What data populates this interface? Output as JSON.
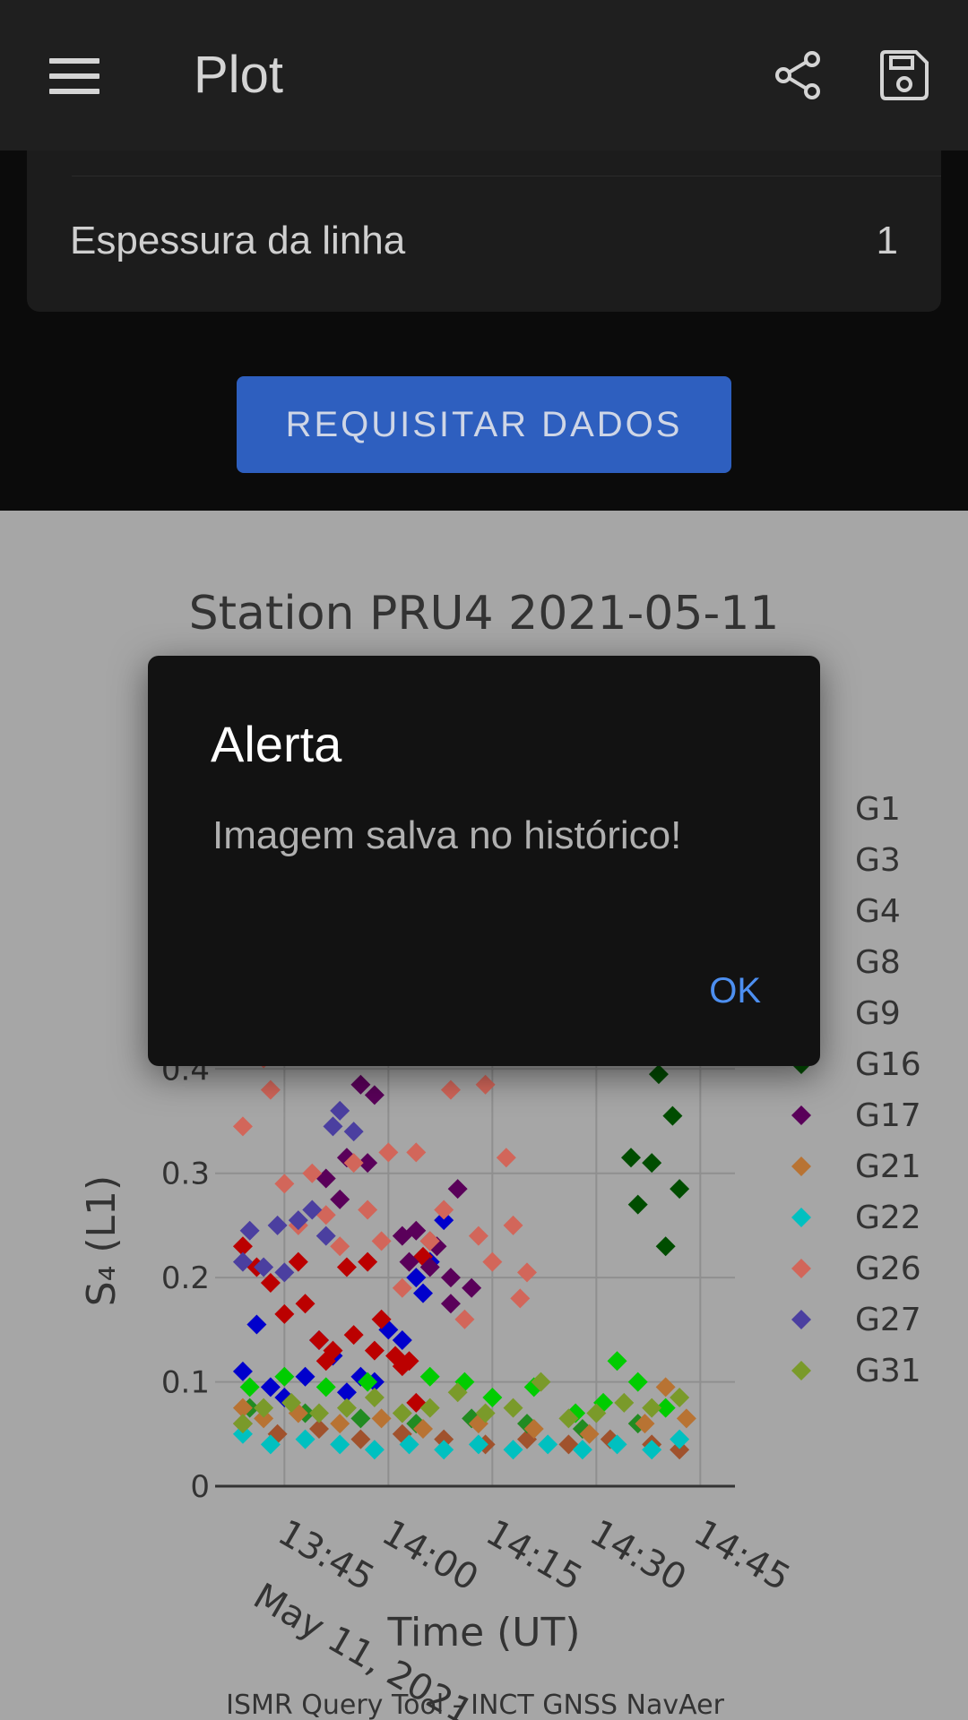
{
  "appbar": {
    "title": "Plot",
    "icons": [
      "menu-icon",
      "share-icon",
      "save-icon"
    ]
  },
  "settings": {
    "line_thickness_label": "Espessura da linha",
    "line_thickness_value": "1"
  },
  "request_button_label": "REQUISITAR DADOS",
  "dialog": {
    "title": "Alerta",
    "message": "Imagem salva no histórico!",
    "ok_label": "OK"
  },
  "colors": {
    "appbar": "#1f1f1f",
    "button": "#2e5fbf",
    "plot_bg": "#a6a6a6",
    "dialog_bg": "#121212",
    "dialog_ok": "#4d8ff0"
  },
  "chart_data": {
    "type": "scatter",
    "title": "Station PRU4 2021-05-11",
    "xlabel": "Time (UT)",
    "ylabel": "S₄ (L1)",
    "x_range": [
      "13:35",
      "14:50"
    ],
    "ylim": [
      0,
      0.42
    ],
    "x_ticks": [
      "13:45",
      "14:00",
      "14:15",
      "14:30",
      "14:45"
    ],
    "x_tick_sublabel": "May 11, 2021",
    "y_ticks": [
      "0",
      "0.1",
      "0.2",
      "0.3",
      "0.4"
    ],
    "grid": true,
    "legend_position": "right",
    "footer": "ISMR Query Tool - INCT GNSS NavAer",
    "marker": "diamond",
    "series": [
      {
        "name": "G1",
        "color": "#0000cc",
        "points": [
          [
            "13:39",
            0.11
          ],
          [
            "13:41",
            0.155
          ],
          [
            "13:43",
            0.095
          ],
          [
            "13:45",
            0.085
          ],
          [
            "13:48",
            0.105
          ],
          [
            "13:50",
            0.14
          ],
          [
            "13:52",
            0.125
          ],
          [
            "13:54",
            0.09
          ],
          [
            "13:56",
            0.105
          ],
          [
            "13:58",
            0.1
          ],
          [
            "14:00",
            0.15
          ],
          [
            "14:02",
            0.14
          ],
          [
            "14:04",
            0.2
          ],
          [
            "14:05",
            0.185
          ],
          [
            "14:06",
            0.215
          ],
          [
            "14:08",
            0.255
          ]
        ]
      },
      {
        "name": "G3",
        "color": "#bb0000",
        "points": [
          [
            "13:39",
            0.23
          ],
          [
            "13:41",
            0.21
          ],
          [
            "13:43",
            0.195
          ],
          [
            "13:45",
            0.165
          ],
          [
            "13:47",
            0.215
          ],
          [
            "13:48",
            0.175
          ],
          [
            "13:50",
            0.14
          ],
          [
            "13:51",
            0.12
          ],
          [
            "13:52",
            0.13
          ],
          [
            "13:54",
            0.21
          ],
          [
            "13:55",
            0.145
          ],
          [
            "13:57",
            0.215
          ],
          [
            "13:58",
            0.13
          ],
          [
            "13:59",
            0.16
          ],
          [
            "14:01",
            0.125
          ],
          [
            "14:02",
            0.115
          ],
          [
            "14:03",
            0.12
          ],
          [
            "14:05",
            0.22
          ],
          [
            "14:06",
            0.235
          ],
          [
            "14:04",
            0.08
          ]
        ]
      },
      {
        "name": "G4",
        "color": "#a0522d",
        "points": [
          [
            "13:39",
            0.06
          ],
          [
            "13:44",
            0.05
          ],
          [
            "13:50",
            0.055
          ],
          [
            "13:56",
            0.045
          ],
          [
            "14:02",
            0.05
          ],
          [
            "14:08",
            0.045
          ],
          [
            "14:14",
            0.04
          ],
          [
            "14:20",
            0.045
          ],
          [
            "14:26",
            0.04
          ],
          [
            "14:32",
            0.045
          ],
          [
            "14:38",
            0.04
          ],
          [
            "14:42",
            0.035
          ]
        ]
      },
      {
        "name": "G8",
        "color": "#228b22",
        "points": [
          [
            "13:40",
            0.075
          ],
          [
            "13:48",
            0.07
          ],
          [
            "13:56",
            0.065
          ],
          [
            "14:04",
            0.06
          ],
          [
            "14:12",
            0.065
          ],
          [
            "14:20",
            0.06
          ],
          [
            "14:28",
            0.055
          ],
          [
            "14:36",
            0.06
          ]
        ]
      },
      {
        "name": "G9",
        "color": "#00cc00",
        "points": [
          [
            "13:40",
            0.095
          ],
          [
            "13:45",
            0.105
          ],
          [
            "13:51",
            0.095
          ],
          [
            "13:57",
            0.1
          ],
          [
            "14:06",
            0.105
          ],
          [
            "14:11",
            0.1
          ],
          [
            "14:15",
            0.085
          ],
          [
            "14:21",
            0.095
          ],
          [
            "14:27",
            0.07
          ],
          [
            "14:31",
            0.08
          ],
          [
            "14:33",
            0.12
          ],
          [
            "14:36",
            0.1
          ],
          [
            "14:40",
            0.075
          ]
        ]
      },
      {
        "name": "G16",
        "color": "#004d00",
        "points": [
          [
            "14:35",
            0.315
          ],
          [
            "14:36",
            0.27
          ],
          [
            "14:38",
            0.31
          ],
          [
            "14:39",
            0.395
          ],
          [
            "14:40",
            0.23
          ],
          [
            "14:41",
            0.355
          ],
          [
            "14:42",
            0.285
          ]
        ]
      },
      {
        "name": "G17",
        "color": "#5a005a",
        "points": [
          [
            "13:51",
            0.295
          ],
          [
            "13:53",
            0.275
          ],
          [
            "13:54",
            0.315
          ],
          [
            "13:56",
            0.385
          ],
          [
            "13:57",
            0.31
          ],
          [
            "13:58",
            0.375
          ],
          [
            "14:02",
            0.24
          ],
          [
            "14:03",
            0.215
          ],
          [
            "14:04",
            0.245
          ],
          [
            "14:06",
            0.21
          ],
          [
            "14:07",
            0.23
          ],
          [
            "14:09",
            0.2
          ],
          [
            "14:10",
            0.285
          ],
          [
            "14:12",
            0.19
          ],
          [
            "14:09",
            0.175
          ]
        ]
      },
      {
        "name": "G21",
        "color": "#b87333",
        "points": [
          [
            "13:39",
            0.075
          ],
          [
            "13:42",
            0.065
          ],
          [
            "13:47",
            0.07
          ],
          [
            "13:53",
            0.06
          ],
          [
            "13:59",
            0.065
          ],
          [
            "14:05",
            0.055
          ],
          [
            "14:13",
            0.06
          ],
          [
            "14:21",
            0.055
          ],
          [
            "14:29",
            0.05
          ],
          [
            "14:37",
            0.06
          ],
          [
            "14:40",
            0.095
          ],
          [
            "14:43",
            0.065
          ]
        ]
      },
      {
        "name": "G22",
        "color": "#00c0c0",
        "points": [
          [
            "13:39",
            0.05
          ],
          [
            "13:43",
            0.04
          ],
          [
            "13:48",
            0.045
          ],
          [
            "13:53",
            0.04
          ],
          [
            "13:58",
            0.035
          ],
          [
            "14:03",
            0.04
          ],
          [
            "14:08",
            0.035
          ],
          [
            "14:13",
            0.04
          ],
          [
            "14:18",
            0.035
          ],
          [
            "14:23",
            0.04
          ],
          [
            "14:28",
            0.035
          ],
          [
            "14:33",
            0.04
          ],
          [
            "14:38",
            0.035
          ],
          [
            "14:42",
            0.045
          ]
        ]
      },
      {
        "name": "G26",
        "color": "#d2665a",
        "points": [
          [
            "13:39",
            0.345
          ],
          [
            "13:42",
            0.41
          ],
          [
            "13:43",
            0.38
          ],
          [
            "13:45",
            0.29
          ],
          [
            "13:47",
            0.25
          ],
          [
            "13:49",
            0.3
          ],
          [
            "13:51",
            0.26
          ],
          [
            "13:53",
            0.23
          ],
          [
            "13:55",
            0.31
          ],
          [
            "13:57",
            0.265
          ],
          [
            "13:59",
            0.235
          ],
          [
            "14:00",
            0.32
          ],
          [
            "14:02",
            0.19
          ],
          [
            "14:04",
            0.32
          ],
          [
            "14:06",
            0.235
          ],
          [
            "14:08",
            0.265
          ],
          [
            "14:09",
            0.38
          ],
          [
            "14:11",
            0.16
          ],
          [
            "14:13",
            0.24
          ],
          [
            "14:14",
            0.385
          ],
          [
            "14:15",
            0.215
          ],
          [
            "14:17",
            0.315
          ],
          [
            "14:18",
            0.25
          ],
          [
            "14:19",
            0.18
          ],
          [
            "14:20",
            0.205
          ]
        ]
      },
      {
        "name": "G27",
        "color": "#4b3fa0",
        "points": [
          [
            "13:39",
            0.215
          ],
          [
            "13:40",
            0.245
          ],
          [
            "13:42",
            0.21
          ],
          [
            "13:44",
            0.25
          ],
          [
            "13:45",
            0.205
          ],
          [
            "13:47",
            0.255
          ],
          [
            "13:49",
            0.265
          ],
          [
            "13:51",
            0.24
          ],
          [
            "13:53",
            0.36
          ],
          [
            "13:55",
            0.34
          ],
          [
            "13:52",
            0.345
          ]
        ]
      },
      {
        "name": "G31",
        "color": "#7a9a2a",
        "points": [
          [
            "13:39",
            0.06
          ],
          [
            "13:42",
            0.075
          ],
          [
            "13:46",
            0.08
          ],
          [
            "13:50",
            0.07
          ],
          [
            "13:54",
            0.075
          ],
          [
            "13:58",
            0.085
          ],
          [
            "14:02",
            0.07
          ],
          [
            "14:06",
            0.075
          ],
          [
            "14:10",
            0.09
          ],
          [
            "14:14",
            0.07
          ],
          [
            "14:18",
            0.075
          ],
          [
            "14:22",
            0.1
          ],
          [
            "14:26",
            0.065
          ],
          [
            "14:30",
            0.07
          ],
          [
            "14:34",
            0.08
          ],
          [
            "14:38",
            0.075
          ],
          [
            "14:42",
            0.085
          ]
        ]
      }
    ]
  }
}
